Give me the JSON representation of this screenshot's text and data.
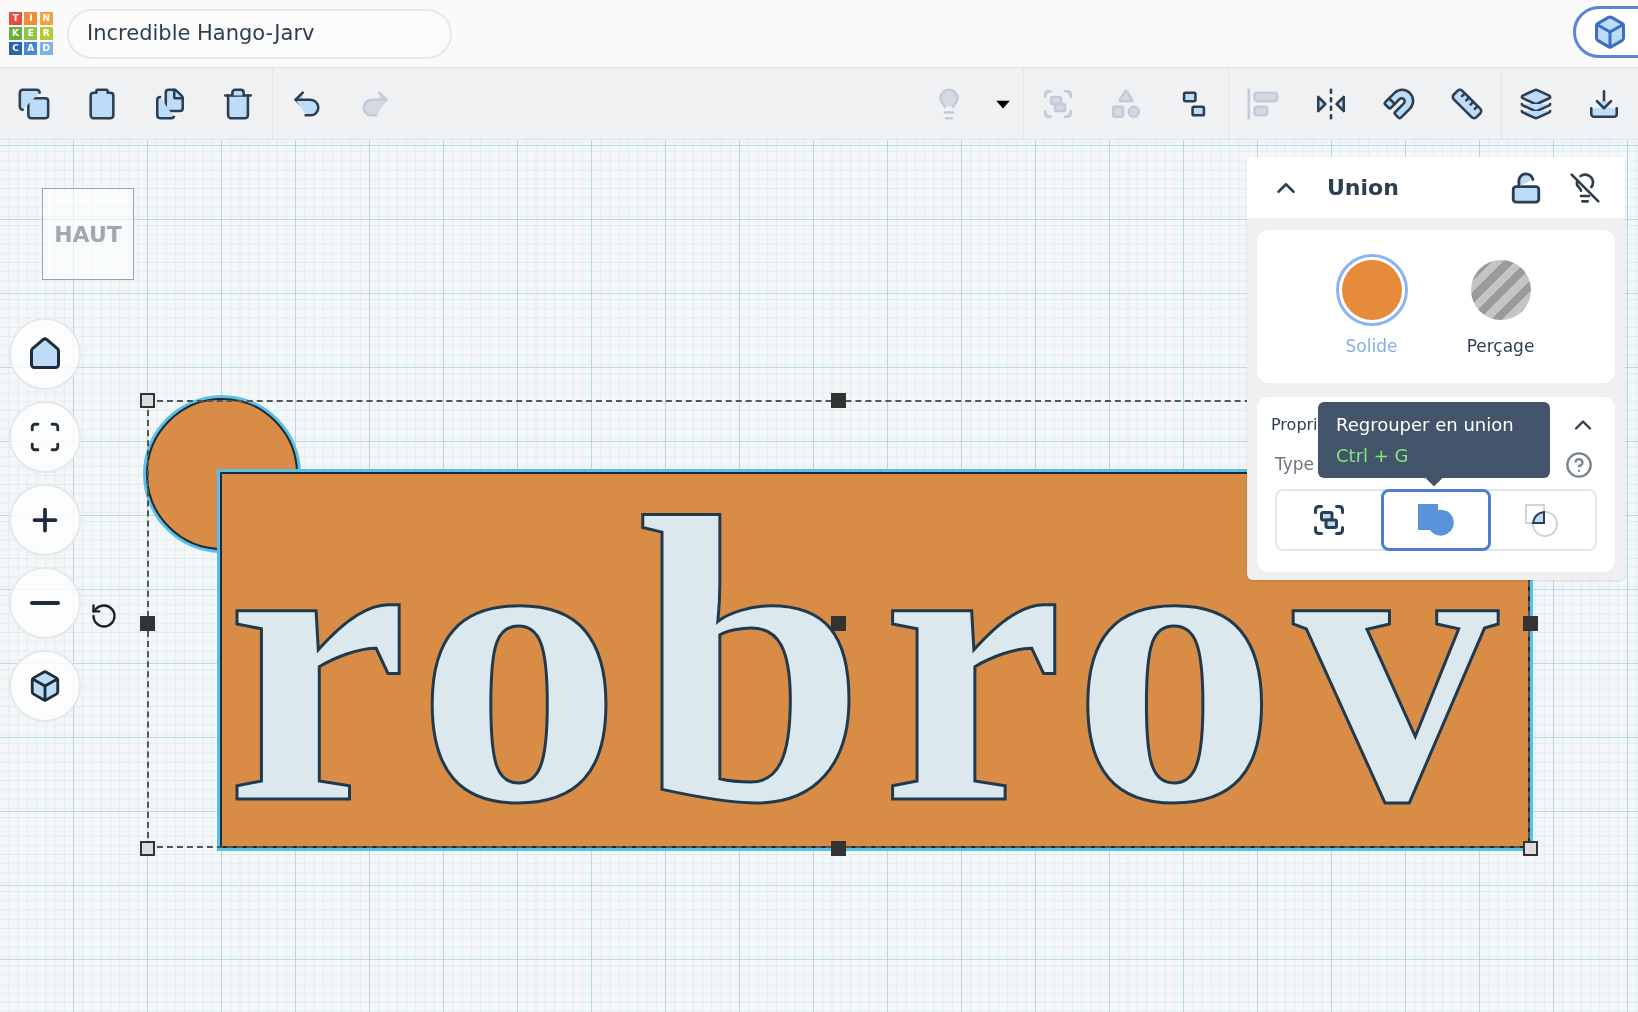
{
  "logo": {
    "letters": [
      "T",
      "I",
      "N",
      "K",
      "E",
      "R",
      "C",
      "A",
      "D"
    ]
  },
  "design_title": "Incredible Hango-Jarv",
  "toolbar": {
    "buttons": [
      {
        "disabled": false
      },
      {
        "disabled": false
      },
      {
        "disabled": false
      },
      {
        "disabled": false
      },
      {
        "disabled": false
      },
      {
        "disabled": true
      },
      {
        "disabled": true
      },
      {
        "disabled": false
      },
      {
        "disabled": true
      },
      {
        "disabled": true
      },
      {
        "disabled": false
      },
      {
        "disabled": true
      },
      {
        "disabled": false
      },
      {
        "disabled": false
      },
      {
        "disabled": false
      },
      {
        "disabled": false
      },
      {
        "disabled": false
      }
    ]
  },
  "view_cube": {
    "label": "HAUT"
  },
  "shape": {
    "text": "robrov"
  },
  "panel": {
    "title": "Union",
    "options": [
      {
        "label": "Solide",
        "selected": true,
        "kind": "solid"
      },
      {
        "label": "Perçage",
        "selected": false,
        "kind": "hole"
      }
    ],
    "properties": {
      "title": "Propri",
      "group_type": "Type",
      "group_buttons": [
        {
          "selected": false
        },
        {
          "selected": true
        },
        {
          "selected": false
        }
      ]
    },
    "tooltip": {
      "text": "Regrouper en union",
      "shortcut": "Ctrl + G"
    }
  }
}
